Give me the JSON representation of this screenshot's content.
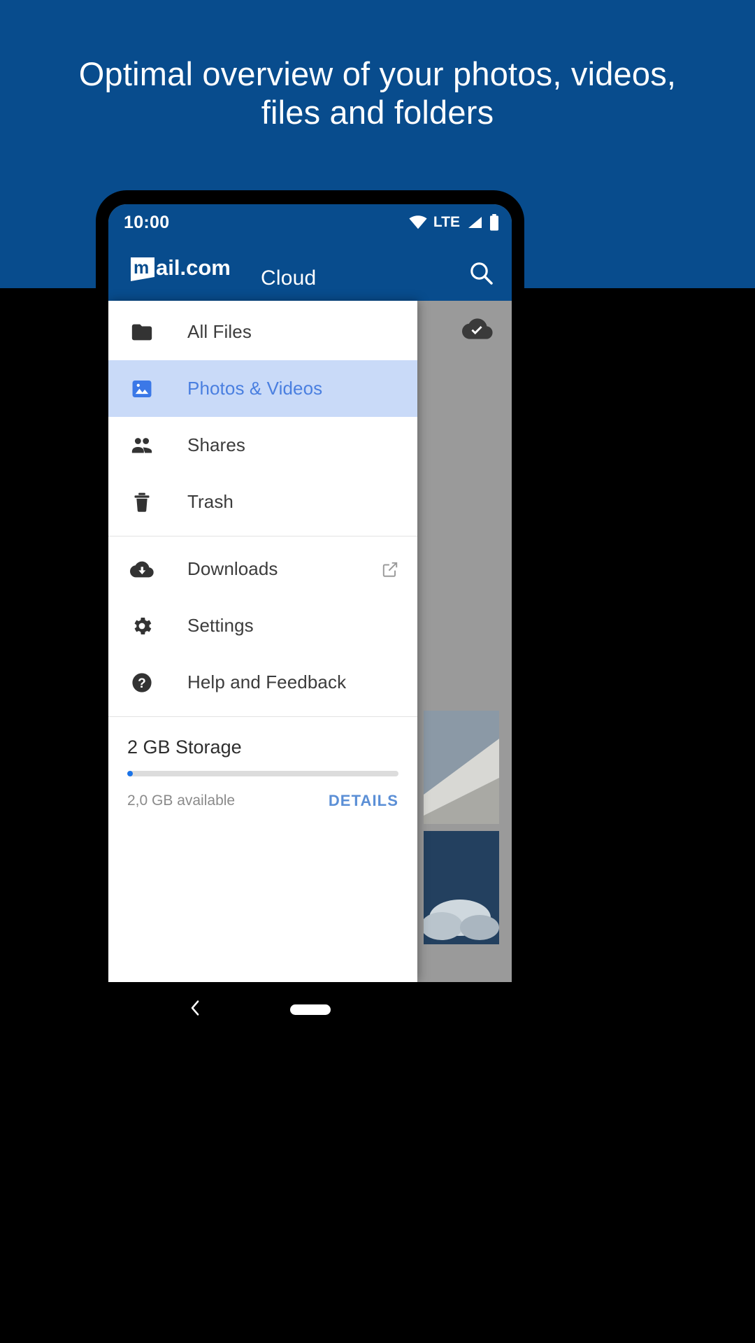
{
  "promo": {
    "headline": "Optimal overview of your photos, videos, files and folders",
    "background_color": "#084c8d"
  },
  "statusbar": {
    "time": "10:00",
    "network_label": "LTE",
    "icons": [
      "wifi-icon",
      "lte-label",
      "signal-icon",
      "battery-icon"
    ]
  },
  "appbar": {
    "brand_mark": "m",
    "brand_name": "ail.com",
    "brand_suffix": "Cloud",
    "search_label": "Search",
    "background_color": "#084c8d"
  },
  "drawer": {
    "items": [
      {
        "label": "All Files",
        "icon": "folder-icon",
        "selected": false,
        "trailing": null
      },
      {
        "label": "Photos & Videos",
        "icon": "image-icon",
        "selected": true,
        "trailing": null
      },
      {
        "label": "Shares",
        "icon": "people-icon",
        "selected": false,
        "trailing": null
      },
      {
        "label": "Trash",
        "icon": "trash-icon",
        "selected": false,
        "trailing": null
      },
      {
        "label": "Downloads",
        "icon": "cloud-download-icon",
        "selected": false,
        "trailing": "external-link-icon"
      },
      {
        "label": "Settings",
        "icon": "gear-icon",
        "selected": false,
        "trailing": null
      },
      {
        "label": "Help and Feedback",
        "icon": "help-circle-icon",
        "selected": false,
        "trailing": null
      }
    ],
    "selected_color": "#4a7fe0",
    "selected_background": "#c9daf8"
  },
  "storage": {
    "title": "2 GB Storage",
    "available": "2,0 GB available",
    "details_label": "DETAILS",
    "used_percent": 2,
    "accent_color": "#1a73e8"
  },
  "content": {
    "sync_badge": "cloud-check-icon",
    "add_button_label": "+",
    "thumbnails": [
      "airplane-wing-photo",
      "clouds-photo"
    ]
  },
  "navbar": {
    "back_label": "Back",
    "home_label": "Home"
  }
}
